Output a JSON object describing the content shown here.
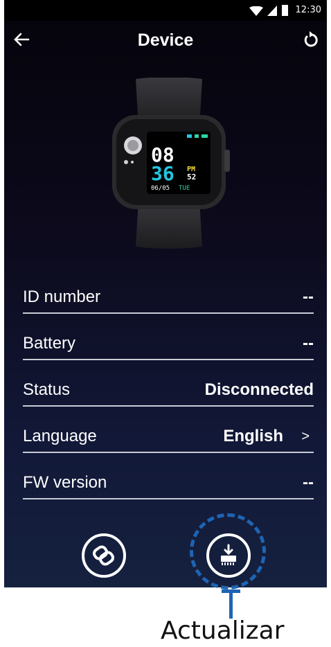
{
  "statusbar": {
    "time": "12:30",
    "icons": [
      "wifi-icon",
      "signal-icon",
      "battery-icon"
    ]
  },
  "appbar": {
    "title": "Device",
    "back_icon": "back-arrow-icon",
    "refresh_icon": "refresh-icon"
  },
  "watch": {
    "hour": "08",
    "minute": "36",
    "ampm": "PM",
    "seconds": "52",
    "date": "06/05",
    "day": "TUE"
  },
  "rows": [
    {
      "label": "ID number",
      "value": "--"
    },
    {
      "label": "Battery",
      "value": "--"
    },
    {
      "label": "Status",
      "value": "Disconnected"
    },
    {
      "label": "Language",
      "value": "English",
      "chevron": ">"
    },
    {
      "label": "FW version",
      "value": "--"
    }
  ],
  "buttons": {
    "link_icon": "link-icon",
    "update_icon": "firmware-update-icon"
  },
  "annotation": {
    "caption": "Actualizar",
    "highlight_color": "#1e64b4"
  },
  "colors": {
    "accent_green": "#2fd4a5",
    "accent_cyan": "#23c6e0",
    "accent_yellow": "#f2d83a"
  }
}
